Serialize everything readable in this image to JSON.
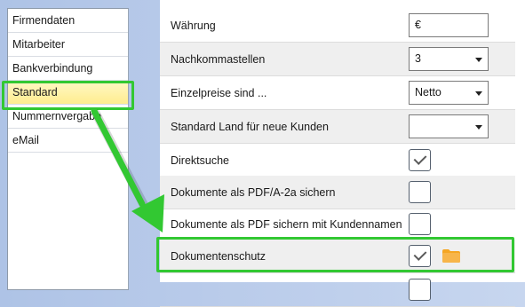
{
  "sidebar": {
    "items": [
      {
        "label": "Firmendaten"
      },
      {
        "label": "Mitarbeiter"
      },
      {
        "label": "Bankverbindung"
      },
      {
        "label": "Standard",
        "selected": true
      },
      {
        "label": "Nummernvergabe"
      },
      {
        "label": "eMail"
      }
    ]
  },
  "settings": {
    "waehrung": {
      "label": "Währung",
      "value": "€"
    },
    "nachkommastellen": {
      "label": "Nachkommastellen",
      "value": "3"
    },
    "einzelpreise": {
      "label": "Einzelpreise sind ...",
      "value": "Netto"
    },
    "standard_land": {
      "label": "Standard Land für neue Kunden",
      "value": ""
    },
    "direktsuche": {
      "label": "Direktsuche",
      "checked": true
    },
    "pdf_a2a": {
      "label": "Dokumente als PDF/A-2a sichern",
      "checked": false
    },
    "pdf_kundennamen": {
      "label": "Dokumente als PDF sichern mit Kundennamen",
      "checked": false
    },
    "dokumentenschutz": {
      "label": "Dokumentenschutz",
      "checked": true,
      "icon": "folder-icon"
    }
  },
  "colors": {
    "highlight": "#32c832",
    "selected_item": "#ffed8f",
    "folder": "#f5a623"
  }
}
